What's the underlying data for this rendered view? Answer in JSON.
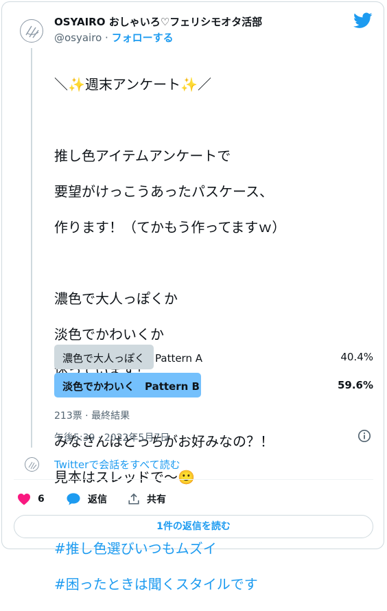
{
  "author": {
    "display_name": "OSYAIRO おしゃいろ♡フェリシモオタ活部",
    "handle": "@osyairo",
    "separator": " · ",
    "follow_label": "フォローする"
  },
  "tweet": {
    "lines": [
      "＼✨週末アンケート✨／",
      "",
      "推し色アイテムアンケートで",
      "要望がけっこうあったパスケース、",
      "作ります！（てかもう作ってますｗ）",
      "",
      "濃色で大人っぽくか",
      "淡色でかわいくか",
      "迷っています！",
      "",
      "みなさんはどっちがお好みなの？！",
      "見本はスレッドで〜🙂",
      ""
    ],
    "hashtags": [
      "#推し色選びいつもムズイ",
      "#困ったときは聞くスタイルです"
    ]
  },
  "poll": {
    "options": [
      {
        "label": "濃色で大人っぽく　Pattern A",
        "percent_text": "40.4%",
        "percent": 40.4,
        "winner": false
      },
      {
        "label": "淡色でかわいく　Pattern B",
        "percent_text": "59.6%",
        "percent": 59.6,
        "winner": true
      }
    ],
    "meta": "213票 · 最終結果",
    "colors": {
      "winner": "#74c0fc",
      "loser": "#cfd9de"
    }
  },
  "timestamp": "午後5:39 · 2022年5月7日",
  "read_conversation": "Twitterで会話をすべて読む",
  "actions": {
    "likes": "6",
    "reply_label": "返信",
    "share_label": "共有"
  },
  "read_replies": "1件の返信を読む",
  "icons": [
    "twitter-logo-icon",
    "info-icon",
    "heart-icon",
    "reply-bubble-icon",
    "share-icon",
    "avatar-logo-icon"
  ],
  "accent": "#1d9bf0",
  "like_color": "#f91880"
}
